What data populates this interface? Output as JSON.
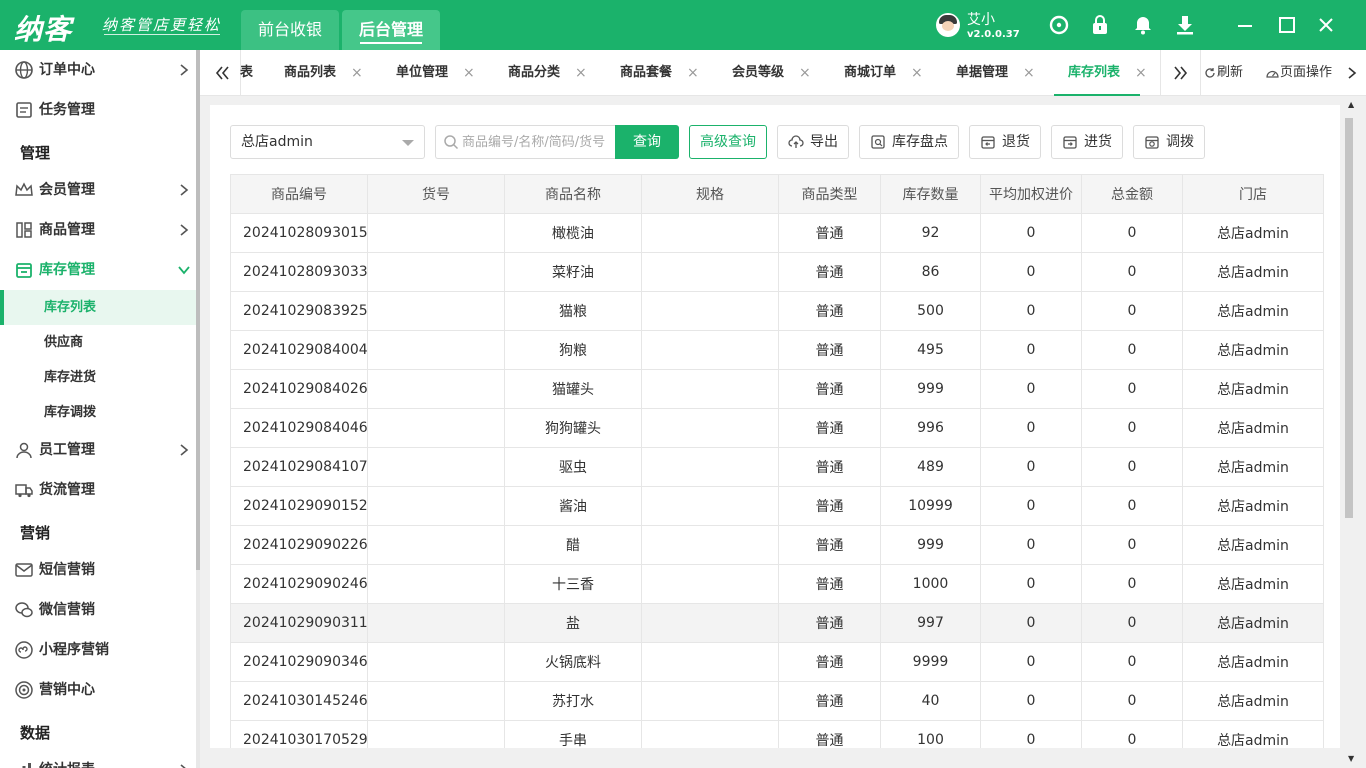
{
  "app": {
    "logo": "纳客",
    "slogan": "纳客管店更轻松",
    "top_tabs": [
      "前台收银",
      "后台管理"
    ],
    "user": {
      "name": "艾小",
      "version": "v2.0.0.37"
    }
  },
  "sidebar": {
    "items": [
      {
        "label": "订单中心"
      },
      {
        "label": "任务管理"
      },
      {
        "label": "会员管理"
      },
      {
        "label": "商品管理"
      },
      {
        "label": "库存管理"
      },
      {
        "label": "员工管理"
      },
      {
        "label": "货流管理"
      },
      {
        "label": "短信营销"
      },
      {
        "label": "微信营销"
      },
      {
        "label": "小程序营销"
      },
      {
        "label": "营销中心"
      },
      {
        "label": "统计报表"
      }
    ],
    "sections": [
      "管理",
      "营销",
      "数据"
    ],
    "sub_items": [
      "库存列表",
      "供应商",
      "库存进货",
      "库存调拨"
    ]
  },
  "tabs": {
    "items": [
      "表",
      "商品列表",
      "单位管理",
      "商品分类",
      "商品套餐",
      "会员等级",
      "商城订单",
      "单据管理",
      "库存列表"
    ],
    "close": "×",
    "refresh": "刷新",
    "page_ops": "页面操作"
  },
  "toolbar": {
    "store": "总店admin",
    "search_placeholder": "商品编号/名称/简码/货号",
    "query": "查询",
    "advanced": "高级查询",
    "export": "导出",
    "stocktake": "库存盘点",
    "return": "退货",
    "purchase": "进货",
    "transfer": "调拨"
  },
  "table": {
    "headers": [
      "商品编号",
      "货号",
      "商品名称",
      "规格",
      "商品类型",
      "库存数量",
      "平均加权进价",
      "总金额",
      "门店"
    ],
    "rows": [
      [
        "20241028093015",
        "",
        "橄榄油",
        "",
        "普通",
        "92",
        "0",
        "0",
        "总店admin"
      ],
      [
        "20241028093033",
        "",
        "菜籽油",
        "",
        "普通",
        "86",
        "0",
        "0",
        "总店admin"
      ],
      [
        "20241029083925",
        "",
        "猫粮",
        "",
        "普通",
        "500",
        "0",
        "0",
        "总店admin"
      ],
      [
        "20241029084004",
        "",
        "狗粮",
        "",
        "普通",
        "495",
        "0",
        "0",
        "总店admin"
      ],
      [
        "20241029084026",
        "",
        "猫罐头",
        "",
        "普通",
        "999",
        "0",
        "0",
        "总店admin"
      ],
      [
        "20241029084046",
        "",
        "狗狗罐头",
        "",
        "普通",
        "996",
        "0",
        "0",
        "总店admin"
      ],
      [
        "20241029084107",
        "",
        "驱虫",
        "",
        "普通",
        "489",
        "0",
        "0",
        "总店admin"
      ],
      [
        "20241029090152",
        "",
        "酱油",
        "",
        "普通",
        "10999",
        "0",
        "0",
        "总店admin"
      ],
      [
        "20241029090226",
        "",
        "醋",
        "",
        "普通",
        "999",
        "0",
        "0",
        "总店admin"
      ],
      [
        "20241029090246",
        "",
        "十三香",
        "",
        "普通",
        "1000",
        "0",
        "0",
        "总店admin"
      ],
      [
        "20241029090311",
        "",
        "盐",
        "",
        "普通",
        "997",
        "0",
        "0",
        "总店admin"
      ],
      [
        "20241029090346",
        "",
        "火锅底料",
        "",
        "普通",
        "9999",
        "0",
        "0",
        "总店admin"
      ],
      [
        "20241030145246",
        "",
        "苏打水",
        "",
        "普通",
        "40",
        "0",
        "0",
        "总店admin"
      ],
      [
        "20241030170529",
        "",
        "手串",
        "",
        "普通",
        "100",
        "0",
        "0",
        "总店admin"
      ]
    ]
  },
  "colors": {
    "accent": "#1bb26b",
    "active_bg": "#e8f7ef"
  }
}
